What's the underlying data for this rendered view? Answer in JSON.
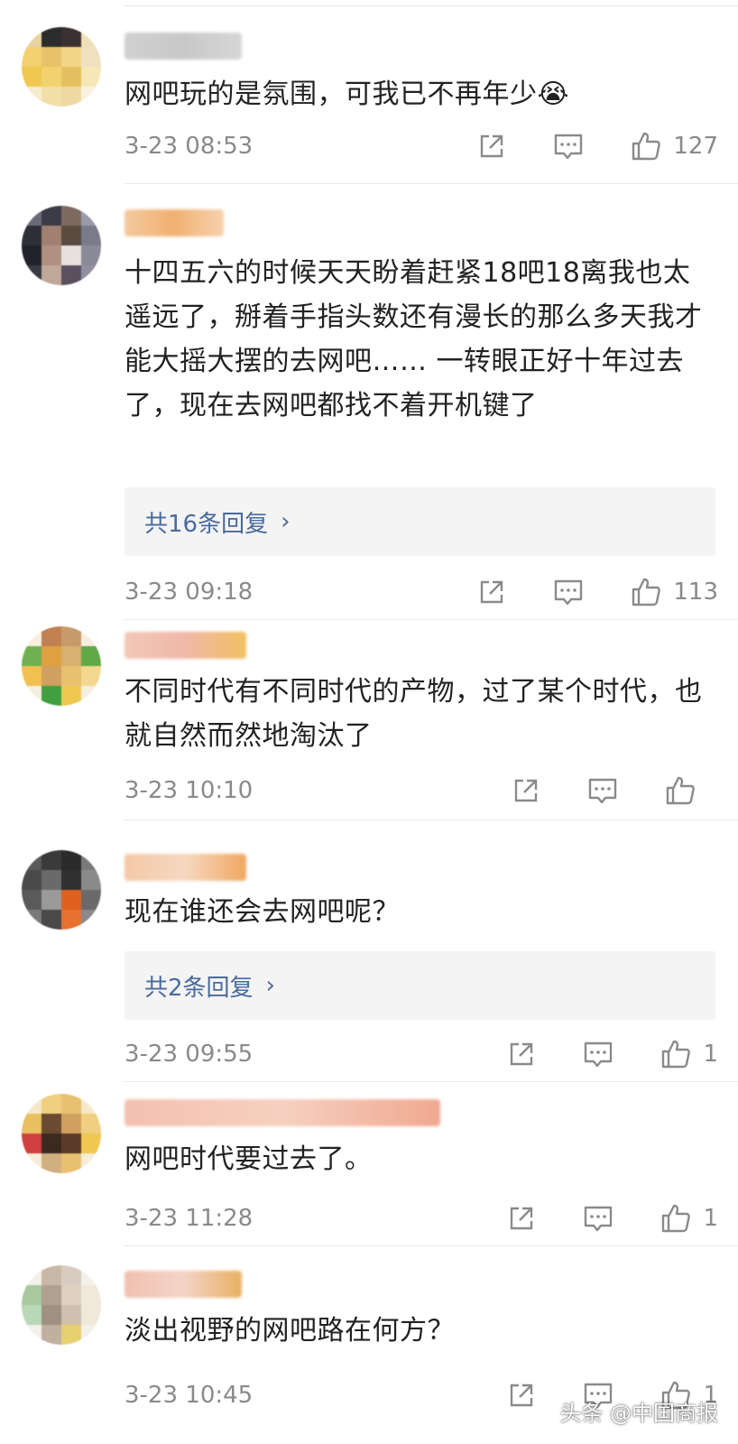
{
  "comments": [
    {
      "text": "网吧玩的是氛围，可我已不再年少😭",
      "time": "3-23 08:53",
      "likes": "127",
      "avatar_colors": [
        "#e8d3a0",
        "#2c2c2c",
        "#3a3030",
        "#f0e0b8",
        "#f3d070",
        "#e8c26a",
        "#f3d58a",
        "#efe0c0",
        "#f0c850",
        "#f2d26e",
        "#e6c060",
        "#f6e7b6",
        "#f7ebcf",
        "#f2dfa8",
        "#efd9a2",
        "#faf2de"
      ],
      "username_colors": [
        "#d0d0d0",
        "#c8c8c8",
        "#d6d6d6"
      ]
    },
    {
      "text": "十四五六的时候天天盼着赶紧18吧18离我也太遥远了，掰着手指头数还有漫长的那么多天我才能大摇大摆的去网吧…… 一转眼正好十年过去了，现在去网吧都找不着开机键了",
      "reply_label": "共16条回复",
      "time": "3-23 09:18",
      "likes": "113",
      "avatar_colors": [
        "#6a6a7a",
        "#3c3c48",
        "#7c6a60",
        "#9a9aa8",
        "#2e2e36",
        "#a08070",
        "#5a4a40",
        "#7a7a88",
        "#22222a",
        "#b09080",
        "#e8e0e0",
        "#8a8a98",
        "#3a3a44",
        "#c0a898",
        "#5a5060",
        "#9090a0"
      ],
      "username_colors": [
        "#f4c9a0",
        "#f0b070",
        "#f6d2b0"
      ]
    },
    {
      "text": "不同时代有不同时代的产物，过了某个时代，也就自然而然地淘汰了",
      "time": "3-23 10:10",
      "likes": "",
      "avatar_colors": [
        "#f6efe0",
        "#c08050",
        "#c89a6a",
        "#f6efe0",
        "#70b050",
        "#e0a040",
        "#d8b070",
        "#60a848",
        "#f0c050",
        "#d0a060",
        "#e8c070",
        "#f4d890",
        "#f4efe0",
        "#40a040",
        "#f0c850",
        "#f6efe0"
      ],
      "username_colors": [
        "#f2c8b8",
        "#f0b8a8",
        "#f0c060"
      ]
    },
    {
      "text": "现在谁还会去网吧呢？",
      "reply_label": "共2条回复",
      "time": "3-23 09:55",
      "likes": "1",
      "avatar_colors": [
        "#5a5a5a",
        "#3a3a3a",
        "#2a2a2a",
        "#7a7a7a",
        "#4a4a4a",
        "#6a6a6a",
        "#303030",
        "#8a8a8a",
        "#5a5a5a",
        "#9a9a9a",
        "#e06020",
        "#6a6a6a",
        "#7a7a7a",
        "#4a4a4a",
        "#e87030",
        "#8a8a8a"
      ],
      "username_colors": [
        "#f4c8a8",
        "#f6d8c0",
        "#f0a860"
      ]
    },
    {
      "text": "网吧时代要过去了。",
      "time": "3-23 11:28",
      "likes": "1",
      "avatar_colors": [
        "#f6e8c8",
        "#f0d080",
        "#e8c070",
        "#f6e8c8",
        "#e8c060",
        "#6a4a30",
        "#d0a060",
        "#f0d080",
        "#d04040",
        "#3a2a20",
        "#5a3a28",
        "#f0c850",
        "#f6ecd8",
        "#d0b080",
        "#e8c070",
        "#f6ecd8"
      ],
      "username_colors": [
        "#f4c0b0",
        "#f6d0c0",
        "#f0a890"
      ]
    },
    {
      "text": "淡出视野的网吧路在何方？",
      "time": "3-23 10:45",
      "likes": "1",
      "avatar_colors": [
        "#f4f0ea",
        "#c8b8a8",
        "#d8ccc0",
        "#f4f0ea",
        "#a8c8a0",
        "#b0a090",
        "#e0d0c0",
        "#f0e8d8",
        "#b8d8b8",
        "#a09080",
        "#d0c0b0",
        "#f0e8d8",
        "#f4f0ea",
        "#c0b0a0",
        "#e8d070",
        "#f4f0ea"
      ],
      "username_colors": [
        "#f0c0b0",
        "#f4d4c8",
        "#e8b060"
      ]
    }
  ],
  "watermark": "头条 @中国商报"
}
